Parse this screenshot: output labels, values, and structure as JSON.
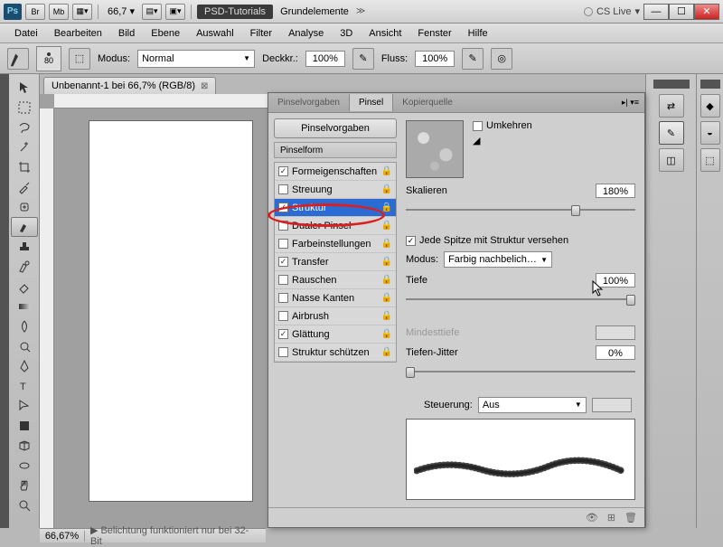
{
  "titlebar": {
    "ps": "Ps",
    "br": "Br",
    "mb": "Mb",
    "zoom": "66,7",
    "psd_tutorials": "PSD-Tutorials",
    "doc_title": "Grundelemente",
    "cs_live": "CS Live"
  },
  "menu": [
    "Datei",
    "Bearbeiten",
    "Bild",
    "Ebene",
    "Auswahl",
    "Filter",
    "Analyse",
    "3D",
    "Ansicht",
    "Fenster",
    "Hilfe"
  ],
  "optbar": {
    "brush_size": "80",
    "modus_label": "Modus:",
    "modus_value": "Normal",
    "deckkr_label": "Deckkr.:",
    "deckkr_value": "100%",
    "fluss_label": "Fluss:",
    "fluss_value": "100%"
  },
  "doctab": "Unbenannt-1 bei 66,7% (RGB/8)",
  "brush_panel": {
    "tabs": [
      "Pinselvorgaben",
      "Pinsel",
      "Kopierquelle"
    ],
    "active_tab": 1,
    "presets_btn": "Pinselvorgaben",
    "section_head": "Pinselform",
    "rows": [
      {
        "label": "Formeigenschaften",
        "checked": true,
        "lock": true
      },
      {
        "label": "Streuung",
        "checked": false,
        "lock": true
      },
      {
        "label": "Struktur",
        "checked": true,
        "lock": true,
        "selected": true
      },
      {
        "label": "Dualer Pinsel",
        "checked": false,
        "lock": true
      },
      {
        "label": "Farbeinstellungen",
        "checked": false,
        "lock": true
      },
      {
        "label": "Transfer",
        "checked": true,
        "lock": true
      },
      {
        "label": "Rauschen",
        "checked": false,
        "lock": true
      },
      {
        "label": "Nasse Kanten",
        "checked": false,
        "lock": true
      },
      {
        "label": "Airbrush",
        "checked": false,
        "lock": true
      },
      {
        "label": "Glättung",
        "checked": true,
        "lock": true
      },
      {
        "label": "Struktur schützen",
        "checked": false,
        "lock": true
      }
    ],
    "umkehren": "Umkehren",
    "skalieren_label": "Skalieren",
    "skalieren_value": "180%",
    "jede_spitze": "Jede Spitze mit Struktur versehen",
    "modus_label": "Modus:",
    "modus_value": "Farbig nachbelich…",
    "tiefe_label": "Tiefe",
    "tiefe_value": "100%",
    "mindesttiefe_label": "Mindesttiefe",
    "tiefen_jitter_label": "Tiefen-Jitter",
    "tiefen_jitter_value": "0%",
    "steuerung_label": "Steuerung:",
    "steuerung_value": "Aus"
  },
  "statusbar": {
    "zoom": "66,67%",
    "msg": "Belichtung funktioniert nur bei 32-Bit"
  }
}
